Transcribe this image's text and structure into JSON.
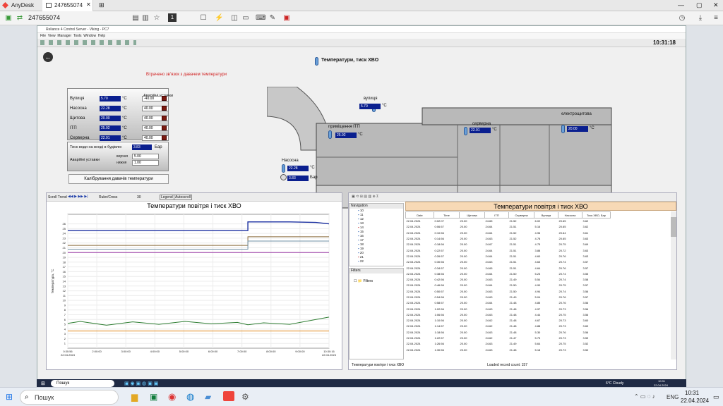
{
  "anydesk": {
    "app": "AnyDesk",
    "tab_id": "247655074",
    "address": "247655074",
    "display_number": "1"
  },
  "remote": {
    "window_title": "Reliance 4 Control Server - Viking - PC7",
    "menu": [
      "File",
      "View",
      "Manager",
      "Tools",
      "Window",
      "Help"
    ],
    "clock": "10:31:18",
    "hmi": {
      "title": "Температури, тиск ХВО",
      "alert": "Втрачено зв'язок з давачем температури",
      "sensors": [
        {
          "label": "Вулиця",
          "value": "5.70",
          "unit": "°C",
          "setpoint": "-40.00"
        },
        {
          "label": "Насосна",
          "value": "22.28",
          "unit": "°C",
          "setpoint": "40.00"
        },
        {
          "label": "Щитова",
          "value": "20.00",
          "unit": "°C",
          "setpoint": "40.00"
        },
        {
          "label": "ІТП",
          "value": "25.92",
          "unit": "°C",
          "setpoint": "40.00"
        },
        {
          "label": "Серверна",
          "value": "22.91",
          "unit": "°C",
          "setpoint": "40.00"
        }
      ],
      "alarm_header": "Аварійні уставки",
      "pressure": {
        "label": "Тиск води на вході в будівлю",
        "value": "3.83",
        "unit": "Бар",
        "alarm_label": "Аварійні уставки",
        "upper_label": "верхня",
        "upper": "5.00",
        "lower_label": "нижня",
        "lower": "1.00"
      },
      "calibrate_button": "Калібрування давачів температури",
      "map": {
        "street": {
          "label": "вулиця",
          "value": "5.70",
          "unit": "°C"
        },
        "itp": {
          "label": "приміщення ІТП",
          "value": "25.92",
          "unit": "°C"
        },
        "server": {
          "label": "серверна",
          "value": "22.91",
          "unit": "°C"
        },
        "electro": {
          "label": "електрощитова",
          "value": "20.00",
          "unit": "°C"
        },
        "pump": {
          "label": "Насосна",
          "temp": "22.28",
          "temp_unit": "°C",
          "pressure": "3.83",
          "pressure_unit": "Бар"
        }
      }
    },
    "trend": {
      "toolbar": [
        "Scroll Trend",
        "Ruler/Cross",
        "30",
        "Legend",
        "Autoscroll"
      ],
      "chart_title": "Температури повітря і тиск ХВО",
      "ylabel": "Температура, °С",
      "xticks": [
        "0:30:56\n22.04.2024",
        "2:00:00",
        "3:00:00",
        "4:00:00",
        "5:00:00",
        "6:00:00",
        "7:00:00",
        "8:00:00",
        "9:00:00",
        "10:30:16\n22.04.2024"
      ]
    },
    "chart_data": {
      "type": "line",
      "title": "Температури повітря і тиск ХВО",
      "ylabel": "Температура, °С",
      "ylim": [
        0,
        28
      ],
      "yticks": [
        1,
        2,
        3,
        4,
        5,
        6,
        7,
        8,
        9,
        10,
        11,
        12,
        13,
        14,
        15,
        16,
        17,
        18,
        19,
        20,
        21,
        22,
        23,
        24,
        25,
        26
      ],
      "x_hours": [
        0.52,
        1,
        2,
        3,
        4,
        5,
        6,
        7,
        7.4,
        8,
        9,
        10,
        10.5
      ],
      "series": [
        {
          "name": "ІТП",
          "color": "#1a2fa0",
          "values": [
            24.6,
            24.6,
            24.6,
            24.6,
            24.6,
            24.6,
            24.6,
            24.6,
            26.4,
            26.4,
            26.4,
            26.3,
            26.0
          ]
        },
        {
          "name": "Серверна",
          "color": "#8a6b3a",
          "values": [
            21.5,
            21.5,
            21.5,
            21.5,
            21.5,
            21.5,
            21.5,
            21.5,
            23.3,
            23.3,
            23.3,
            23.3,
            23.3
          ]
        },
        {
          "name": "Насосна",
          "color": "#6f8fa5",
          "values": [
            20.7,
            20.7,
            20.7,
            20.7,
            20.7,
            20.7,
            20.7,
            20.7,
            22.4,
            22.4,
            22.4,
            22.4,
            22.4
          ]
        },
        {
          "name": "Щитова",
          "color": "#9b3fa8",
          "values": [
            20.0,
            20.0,
            20.0,
            20.0,
            20.0,
            20.0,
            20.0,
            20.0,
            20.0,
            20.0,
            20.0,
            20.0,
            20.0
          ]
        },
        {
          "name": "Вулиця",
          "color": "#2e7d32",
          "values": [
            5.2,
            5.6,
            4.8,
            5.5,
            5.0,
            5.6,
            5.1,
            5.4,
            4.9,
            5.3,
            5.0,
            6.0,
            6.5
          ]
        },
        {
          "name": "Тиск ХВО",
          "color": "#e08a1e",
          "values": [
            3.6,
            3.6,
            3.6,
            3.6,
            3.6,
            3.6,
            3.6,
            3.6,
            3.6,
            3.6,
            3.6,
            3.6,
            3.6
          ]
        }
      ]
    },
    "table": {
      "title": "Температури повітря і тиск ХВО",
      "nav_label": "Navigation",
      "filters_label": "Filters",
      "filter_item": "Filters",
      "nav_items": [
        "10",
        "11",
        "12",
        "13",
        "14",
        "15",
        "16",
        "17",
        "18",
        "19",
        "20",
        "21",
        "22"
      ],
      "headers": [
        "Date",
        "Time",
        "Щитова",
        "ІТП",
        "Серверна",
        "Вулиця",
        "Насосна",
        "Тиск ХВО, Бар"
      ],
      "rows": [
        [
          "22.04.2024",
          "0:02:07",
          "20.00",
          "24.65",
          "21.52",
          "6.02",
          "20.65",
          "3.62"
        ],
        [
          "22.04.2024",
          "0:06:57",
          "20.00",
          "24.64",
          "21.51",
          "5.16",
          "20.65",
          "3.62"
        ],
        [
          "22.04.2024",
          "0:10:56",
          "20.00",
          "24.64",
          "21.52",
          "4.96",
          "20.64",
          "3.61"
        ],
        [
          "22.04.2024",
          "0:14:56",
          "20.00",
          "24.63",
          "21.52",
          "4.78",
          "20.65",
          "3.63"
        ],
        [
          "22.04.2024",
          "0:18:56",
          "20.00",
          "24.67",
          "21.51",
          "4.75",
          "20.75",
          "3.69"
        ],
        [
          "22.04.2024",
          "0:22:57",
          "20.00",
          "24.64",
          "21.51",
          "3.88",
          "20.72",
          "3.63"
        ],
        [
          "22.04.2024",
          "0:26:57",
          "20.00",
          "24.64",
          "21.51",
          "4.60",
          "20.76",
          "3.63"
        ],
        [
          "22.04.2024",
          "0:30:56",
          "20.00",
          "24.63",
          "21.51",
          "4.63",
          "20.74",
          "3.57"
        ],
        [
          "22.04.2024",
          "0:34:57",
          "20.00",
          "24.65",
          "21.51",
          "4.64",
          "20.76",
          "3.57"
        ],
        [
          "22.04.2024",
          "0:38:56",
          "20.00",
          "24.64",
          "21.50",
          "5.23",
          "20.74",
          "3.55"
        ],
        [
          "22.04.2024",
          "0:42:56",
          "20.00",
          "24.63",
          "21.49",
          "5.54",
          "20.74",
          "3.58"
        ],
        [
          "22.04.2024",
          "0:46:56",
          "20.00",
          "24.64",
          "21.50",
          "4.90",
          "20.75",
          "3.57"
        ],
        [
          "22.04.2024",
          "0:50:57",
          "20.00",
          "24.63",
          "21.50",
          "4.94",
          "20.74",
          "3.56"
        ],
        [
          "22.04.2024",
          "0:54:56",
          "20.00",
          "24.63",
          "21.49",
          "5.04",
          "20.76",
          "3.57"
        ],
        [
          "22.04.2024",
          "0:58:57",
          "20.00",
          "24.64",
          "21.48",
          "4.85",
          "20.76",
          "3.56"
        ],
        [
          "22.04.2024",
          "1:02:56",
          "20.00",
          "24.63",
          "21.48",
          "4.97",
          "20.73",
          "3.56"
        ],
        [
          "22.04.2024",
          "1:06:56",
          "20.00",
          "24.63",
          "21.48",
          "4.44",
          "20.75",
          "3.56"
        ],
        [
          "22.04.2024",
          "1:10:56",
          "20.00",
          "24.62",
          "21.48",
          "4.67",
          "20.73",
          "3.60"
        ],
        [
          "22.04.2024",
          "1:14:57",
          "20.00",
          "24.62",
          "21.48",
          "4.88",
          "20.73",
          "3.60"
        ],
        [
          "22.04.2024",
          "1:18:56",
          "20.00",
          "24.63",
          "21.48",
          "5.30",
          "20.76",
          "3.56"
        ],
        [
          "22.04.2024",
          "1:22:57",
          "20.00",
          "24.62",
          "21.47",
          "5.73",
          "20.73",
          "3.59"
        ],
        [
          "22.04.2024",
          "1:26:56",
          "20.00",
          "24.63",
          "21.49",
          "5.64",
          "20.75",
          "3.52"
        ],
        [
          "22.04.2024",
          "1:30:56",
          "20.00",
          "24.63",
          "21.48",
          "5.18",
          "20.73",
          "3.50"
        ]
      ],
      "status_left": "Температури повітря і тиск ХВО",
      "status_right": "Loaded record count: 157"
    }
  },
  "taskbar": {
    "inner_search": "Пошук",
    "inner_weather": "6°C Cloudy",
    "inner_time": "10:31",
    "inner_date": "22.04.2024",
    "search": "Пошук",
    "lang": "ENG",
    "time": "10:31",
    "date": "22.04.2024"
  }
}
